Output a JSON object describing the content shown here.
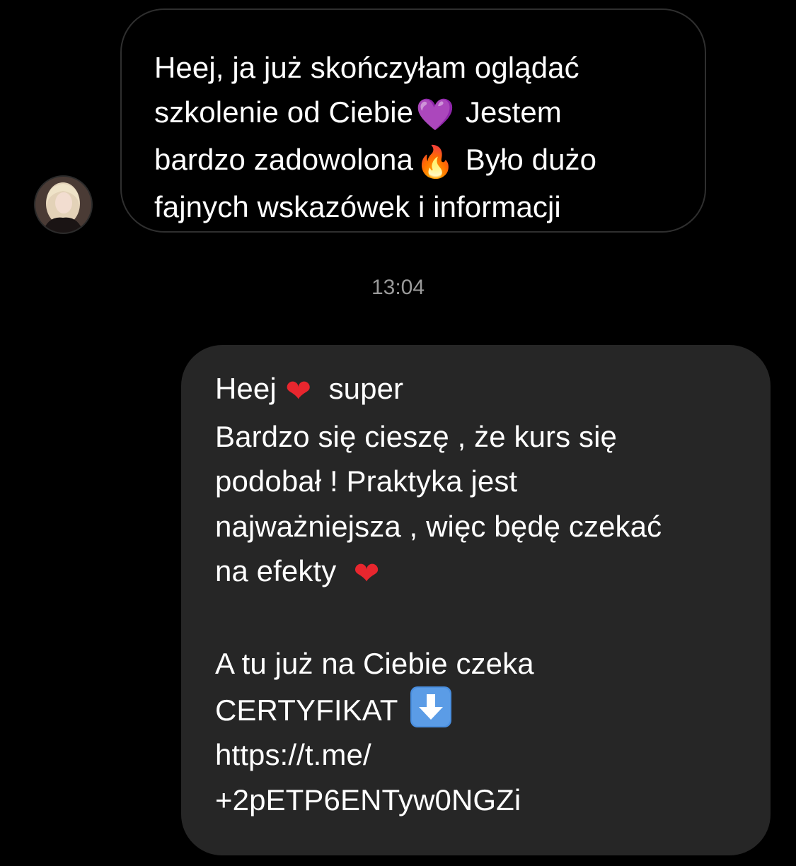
{
  "conversation": {
    "incoming": {
      "avatar_icon": "user-avatar-photo",
      "lines": [
        "Heej, ja już skończyłam oglądać",
        "szkolenie od Ciebie",
        "Jestem",
        "bardzo zadowolona",
        "Było dużo",
        "fajnych wskazówek i informacji"
      ],
      "emoji_purple_heart": "💜",
      "emoji_fire": "🔥"
    },
    "timestamp": "13:04",
    "outgoing": {
      "line1_a": "Heej",
      "line1_b": "super",
      "emoji_red_heart": "❤",
      "line2": "Bardzo się cieszę , że kurs się",
      "line3": "podobał ! Praktyka jest",
      "line4": "najważniejsza , więc będę czekać",
      "line5": "na efekty",
      "line6": "A tu już na Ciebie czeka",
      "line7": "CERTYFIKAT",
      "arrow_icon": "down-arrow-emoji-icon",
      "link_line1": "https://t.me/",
      "link_line2": "+2pETP6ENTyw0NGZi"
    }
  },
  "colors": {
    "background": "#000000",
    "outgoing_bubble": "#262626",
    "incoming_border": "#2f2f2f",
    "timestamp": "#9a9a9a"
  }
}
